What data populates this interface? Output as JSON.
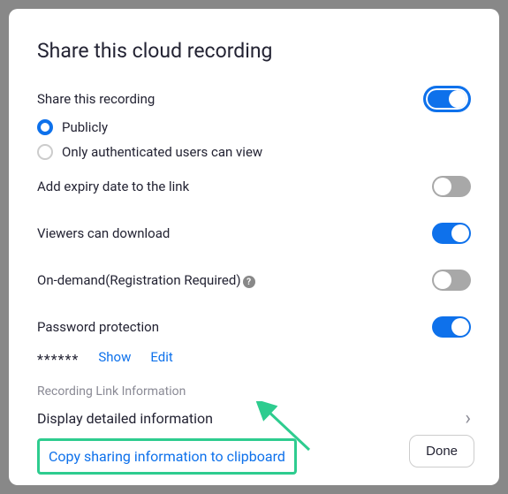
{
  "title": "Share this cloud recording",
  "shareThisRecording": {
    "label": "Share this recording",
    "options": {
      "publicly": "Publicly",
      "authOnly": "Only authenticated users can view"
    }
  },
  "toggles": {
    "expiry": "Add expiry date to the link",
    "download": "Viewers can download",
    "ondemand": "On-demand(Registration Required)",
    "password": "Password protection"
  },
  "password": {
    "mask": "******",
    "show": "Show",
    "edit": "Edit"
  },
  "linkInfo": {
    "sectionLabel": "Recording Link Information",
    "displayDetail": "Display detailed information",
    "copy": "Copy sharing information to clipboard"
  },
  "doneLabel": "Done"
}
